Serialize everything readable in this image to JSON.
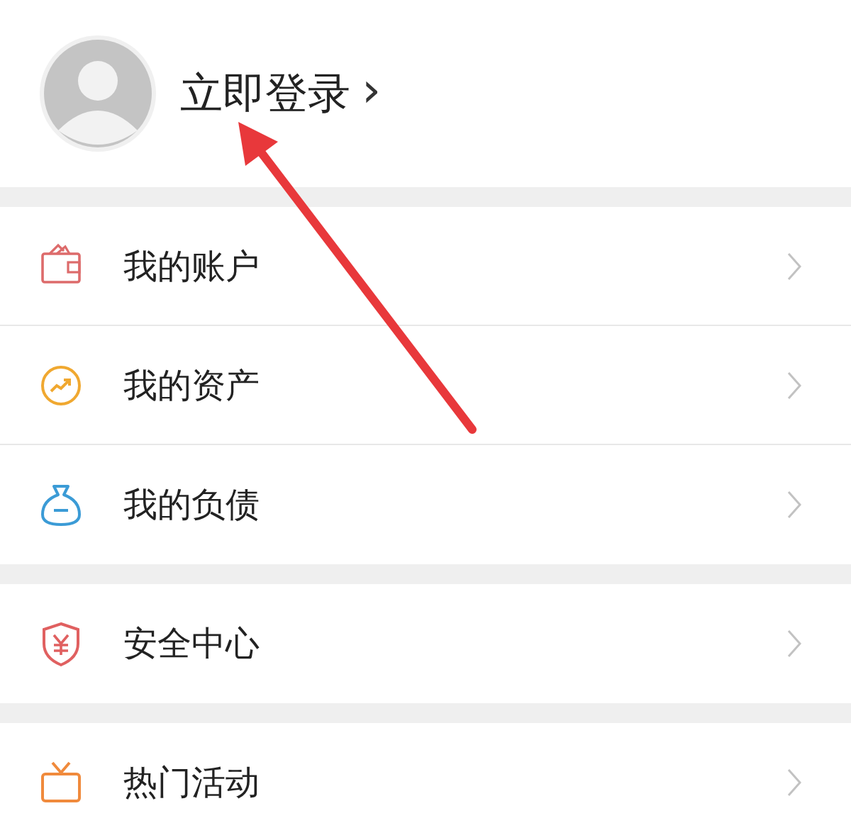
{
  "profile": {
    "login_label": "立即登录",
    "chevron": "›"
  },
  "groups": [
    {
      "items": [
        {
          "kind": "wallet",
          "label": "我的账户"
        },
        {
          "kind": "trend",
          "label": "我的资产"
        },
        {
          "kind": "bag",
          "label": "我的负债"
        }
      ]
    },
    {
      "items": [
        {
          "kind": "shield",
          "label": "安全中心"
        }
      ]
    },
    {
      "items": [
        {
          "kind": "tv",
          "label": "热门活动"
        }
      ]
    }
  ],
  "annotation": {
    "kind": "arrow"
  }
}
